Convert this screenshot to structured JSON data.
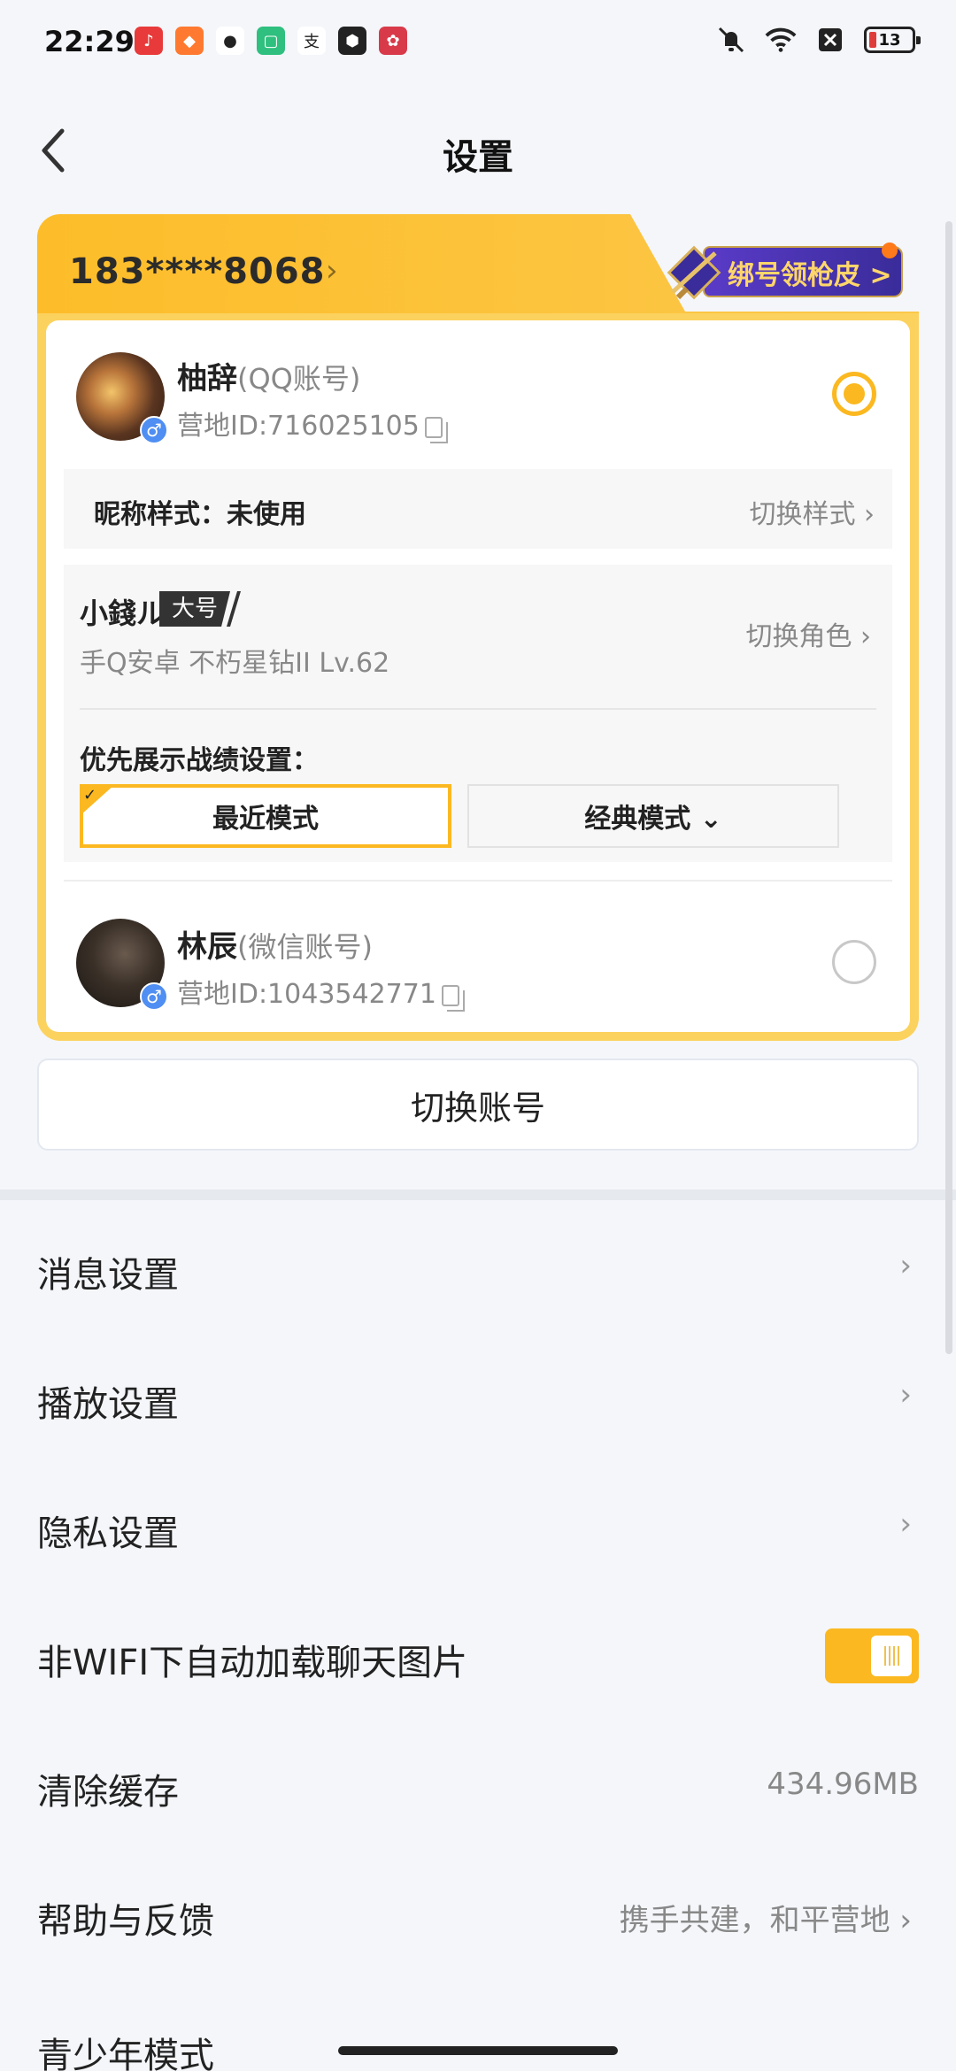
{
  "status_bar": {
    "time": "22:29",
    "battery": "13"
  },
  "header": {
    "title": "设置"
  },
  "account": {
    "phone": "183****8068",
    "skin_badge": "绑号领枪皮 >",
    "users": [
      {
        "name": "柚辞",
        "type": "(QQ账号)",
        "camp_id": "营地ID:716025105",
        "selected": true
      },
      {
        "name": "林辰",
        "type": "(微信账号)",
        "camp_id": "营地ID:1043542771",
        "selected": false
      }
    ],
    "nickname_style_label": "昵称样式：未使用",
    "nickname_style_action": "切换样式 ›",
    "role": {
      "name": "小錢ル",
      "tag": "大号",
      "subtitle": "手Q安卓  不朽星钻II  Lv.62",
      "switch_label": "切换角色 ›"
    },
    "pref_label": "优先展示战绩设置：",
    "mode_recent": "最近模式",
    "mode_classic": "经典模式 ⌄"
  },
  "switch_account": "切换账号",
  "menu": {
    "items": [
      {
        "label": "消息设置",
        "chevron": "›"
      },
      {
        "label": "播放设置",
        "chevron": "›"
      },
      {
        "label": "隐私设置",
        "chevron": "›"
      },
      {
        "label": "非WIFI下自动加载聊天图片",
        "toggle": true
      },
      {
        "label": "清除缓存",
        "value": "434.96MB"
      },
      {
        "label": "帮助与反馈",
        "value": "携手共建，和平营地 ›"
      }
    ],
    "cutoff_label": "青少年模式"
  },
  "colors": {
    "accent": "#fbb820",
    "background": "#f4f6fa"
  }
}
